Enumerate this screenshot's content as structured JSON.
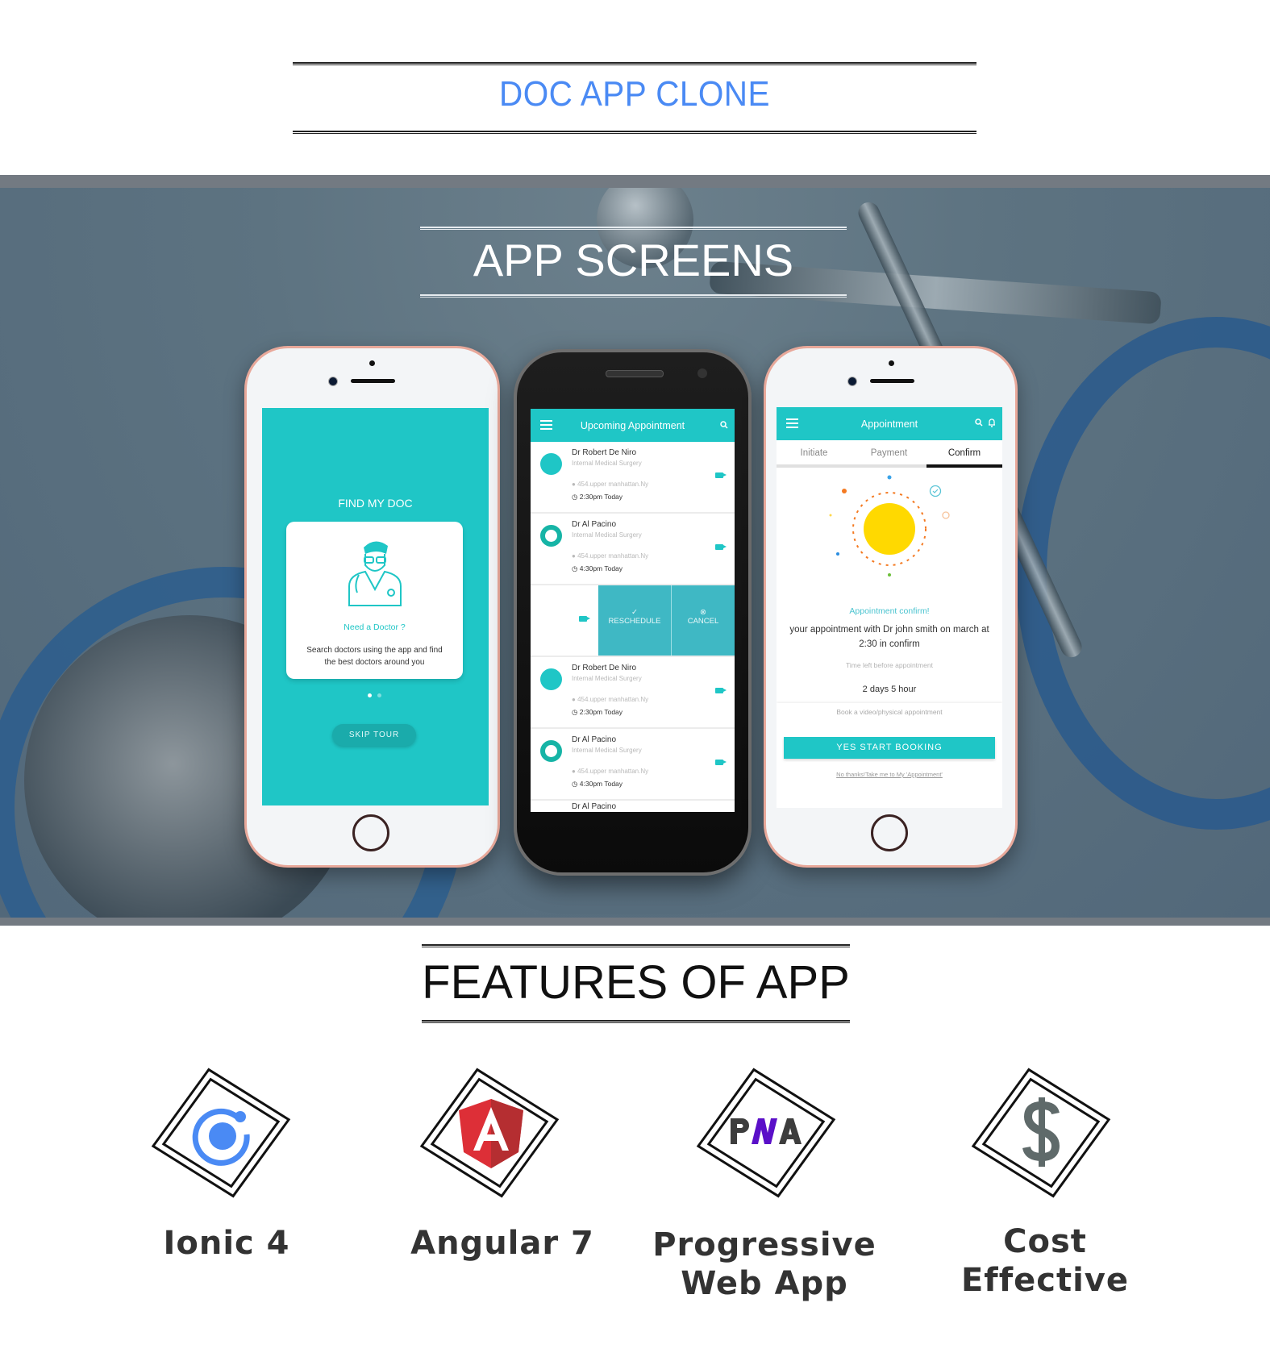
{
  "header": {
    "title": "DOC APP CLONE",
    "title_color": "#4a8af4"
  },
  "hero": {
    "title": "APP SCREENS",
    "phone_onboarding": {
      "heading": "FIND MY DOC",
      "card_title": "Need a Doctor ?",
      "card_text": "Search doctors using the app and find the best doctors around you",
      "pager": {
        "count": 2,
        "active": 1
      },
      "skip_label": "SKIP TOUR"
    },
    "phone_upcoming": {
      "appbar_title": "Upcoming Appointment",
      "menu_icon": "hamburger-icon",
      "search_icon": "search-icon",
      "appointments": [
        {
          "name": "Dr Robert De Niro",
          "specialty": "Internal Medical Surgery",
          "address": "454.upper manhattan.Ny",
          "time": "2:30pm Today",
          "avatar": "star-logo"
        },
        {
          "name": "Dr Al Pacino",
          "specialty": "Internal Medical Surgery",
          "address": "454.upper manhattan.Ny",
          "time": "4:30pm Today",
          "avatar": "ring-logo"
        },
        {
          "name": "Dr Robert De Niro",
          "specialty": "Internal Medical Surgery",
          "address": "454.upper manhattan.Ny",
          "time": "2:30pm Today",
          "avatar": "star-logo"
        },
        {
          "name": "Dr Al Pacino",
          "specialty": "Internal Medical Surgery",
          "address": "454.upper manhattan.Ny",
          "time": "4:30pm Today",
          "avatar": "ring-logo"
        },
        {
          "name": "Dr Al Pacino"
        }
      ],
      "swipe_actions": {
        "reschedule": "RESCHEDULE",
        "cancel": "CANCEL"
      }
    },
    "phone_confirm": {
      "appbar_title": "Appointment",
      "tabs": [
        "Initiate",
        "Payment",
        "Confirm"
      ],
      "active_tab": "Confirm",
      "confirm_heading": "Appointment confirm!",
      "confirm_text": "your appointment with Dr john smith on march at 2:30 in confirm",
      "time_left_label": "Time left before appointment",
      "time_left_value": "2 days 5 hour",
      "book_label": "Book a video/physical appointment",
      "primary_button": "YES START BOOKING",
      "secondary_link": "No thanks!Take me to My 'Appointment'"
    }
  },
  "features": {
    "title": "FEATURES OF APP",
    "items": [
      {
        "label_line1": "Ionic 4",
        "label_line2": "",
        "icon": "ionic-logo-icon",
        "color": "#4a8af4"
      },
      {
        "label_line1": "Angular 7",
        "label_line2": "",
        "icon": "angular-logo-icon",
        "color": "#dd2f37"
      },
      {
        "label_line1": "Progressive",
        "label_line2": "Web App",
        "icon": "pwa-logo-icon",
        "color": "#5a0fc8"
      },
      {
        "label_line1": "Cost",
        "label_line2": "Effective",
        "icon": "dollar-icon",
        "color": "#5f6a6a"
      }
    ]
  },
  "colors": {
    "teal": "#1fc6c6",
    "hero_bg": "#5d7381"
  }
}
